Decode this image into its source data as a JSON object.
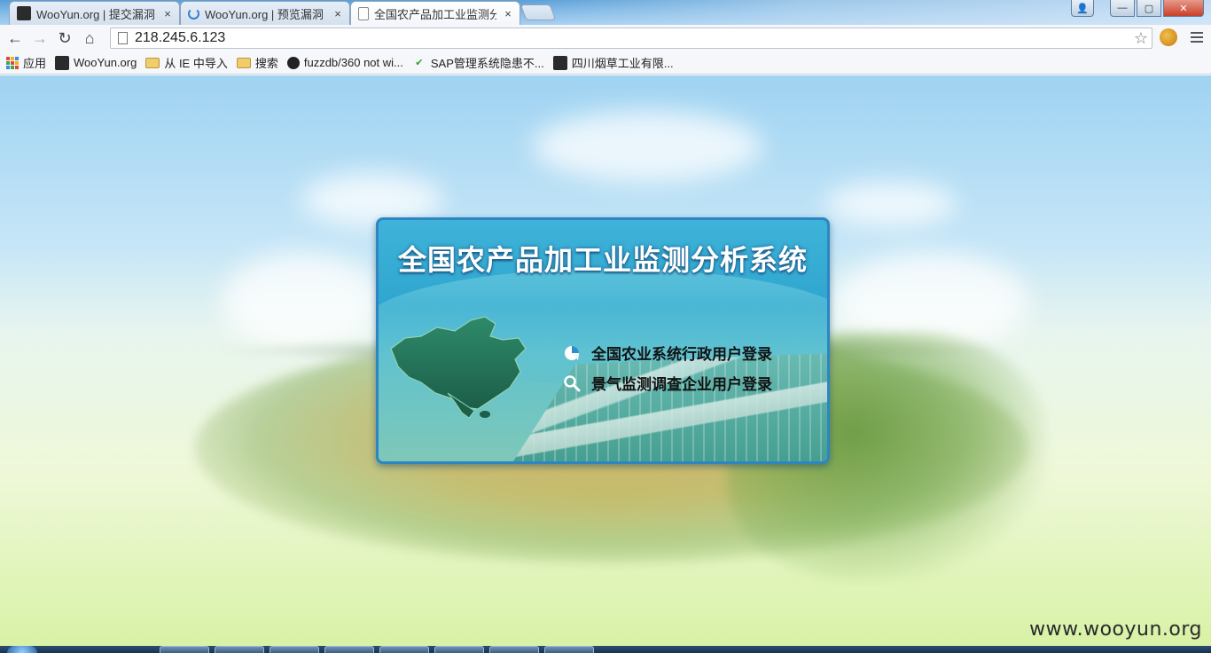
{
  "tabs": [
    {
      "title": "WooYun.org | 提交漏洞",
      "favicon": "wooyun-icon",
      "active": false
    },
    {
      "title": "WooYun.org | 预览漏洞",
      "favicon": "loading-spinner-icon",
      "active": false
    },
    {
      "title": "全国农产品加工业监测分析",
      "favicon": "page-icon",
      "active": true
    }
  ],
  "tab_close_glyph": "×",
  "window_controls": {
    "minimize": "—",
    "maximize": "▢",
    "close": "✕",
    "user": "👤"
  },
  "toolbar": {
    "back": "←",
    "forward": "→",
    "reload": "↻",
    "home": "⌂",
    "url": "218.245.6.123",
    "star": "☆"
  },
  "bookmarks": [
    {
      "label": "应用",
      "icon": "apps-grid-icon"
    },
    {
      "label": "WooYun.org",
      "icon": "wooyun-icon"
    },
    {
      "label": "从 IE 中导入",
      "icon": "folder-icon"
    },
    {
      "label": "搜索",
      "icon": "folder-icon"
    },
    {
      "label": "fuzzdb/360 not wi...",
      "icon": "github-icon"
    },
    {
      "label": "SAP管理系统隐患不...",
      "icon": "checkmark-icon"
    },
    {
      "label": "四川烟草工业有限...",
      "icon": "wooyun-icon"
    }
  ],
  "panel": {
    "title": "全国农产品加工业监测分析系统",
    "links": [
      {
        "label": "全国农业系统行政用户登录",
        "icon": "pie-chart-icon"
      },
      {
        "label": "景气监测调查企业用户登录",
        "icon": "magnifier-icon"
      }
    ]
  },
  "watermark": "www.wooyun.org",
  "colors": {
    "panel_border": "#2d86c2",
    "panel_top": "#3fb3d9",
    "sky": "#9fd3f2",
    "grass": "#d8f2a6"
  }
}
